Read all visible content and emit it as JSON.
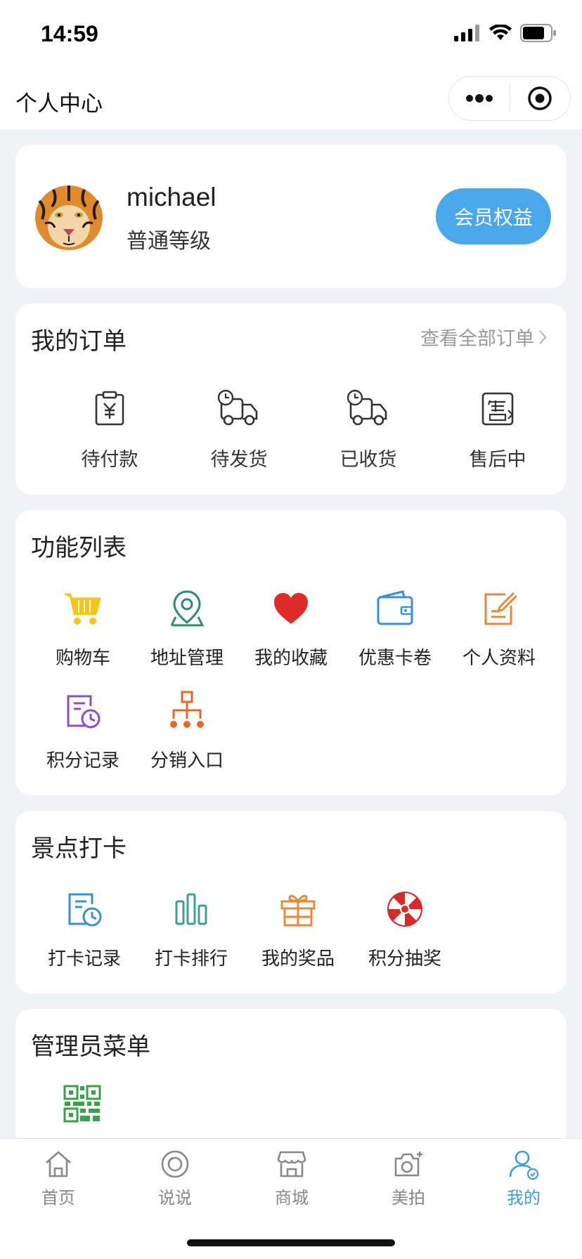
{
  "status_bar": {
    "time": "14:59"
  },
  "nav": {
    "title": "个人中心"
  },
  "profile": {
    "username": "michael",
    "level": "普通等级",
    "vip_button": "会员权益"
  },
  "orders": {
    "title": "我的订单",
    "view_all": "查看全部订单",
    "items": [
      {
        "label": "待付款",
        "icon": "payment-pending-icon"
      },
      {
        "label": "待发货",
        "icon": "truck-clock-icon"
      },
      {
        "label": "已收货",
        "icon": "truck-clock-icon"
      },
      {
        "label": "售后中",
        "icon": "after-sale-icon"
      }
    ]
  },
  "functions": {
    "title": "功能列表",
    "items": [
      {
        "label": "购物车",
        "icon": "shopping-cart-icon",
        "color": "#f5c518"
      },
      {
        "label": "地址管理",
        "icon": "location-pin-icon",
        "color": "#2e8b6e"
      },
      {
        "label": "我的收藏",
        "icon": "heart-icon",
        "color": "#e02b2b"
      },
      {
        "label": "优惠卡卷",
        "icon": "wallet-icon",
        "color": "#3a8fd8"
      },
      {
        "label": "个人资料",
        "icon": "edit-note-icon",
        "color": "#e58a3c"
      },
      {
        "label": "积分记录",
        "icon": "points-record-icon",
        "color": "#8a4fc8"
      },
      {
        "label": "分销入口",
        "icon": "org-tree-icon",
        "color": "#e06a2c"
      }
    ]
  },
  "checkin": {
    "title": "景点打卡",
    "items": [
      {
        "label": "打卡记录",
        "icon": "checkin-record-icon",
        "color": "#3a8fd8"
      },
      {
        "label": "打卡排行",
        "icon": "bar-rank-icon",
        "color": "#3fa08a"
      },
      {
        "label": "我的奖品",
        "icon": "gift-icon",
        "color": "#e58a3c"
      },
      {
        "label": "积分抽奖",
        "icon": "lottery-wheel-icon",
        "color": "#d92a2a"
      }
    ]
  },
  "admin": {
    "title": "管理员菜单",
    "qr_icon": "qr-code-icon",
    "color": "#3aa04a"
  },
  "tabbar": {
    "items": [
      {
        "label": "首页",
        "icon": "home-icon"
      },
      {
        "label": "说说",
        "icon": "chat-circle-icon"
      },
      {
        "label": "商城",
        "icon": "store-icon"
      },
      {
        "label": "美拍",
        "icon": "camera-icon"
      },
      {
        "label": "我的",
        "icon": "user-icon",
        "active": true
      }
    ],
    "active_color": "#3d9be5"
  }
}
